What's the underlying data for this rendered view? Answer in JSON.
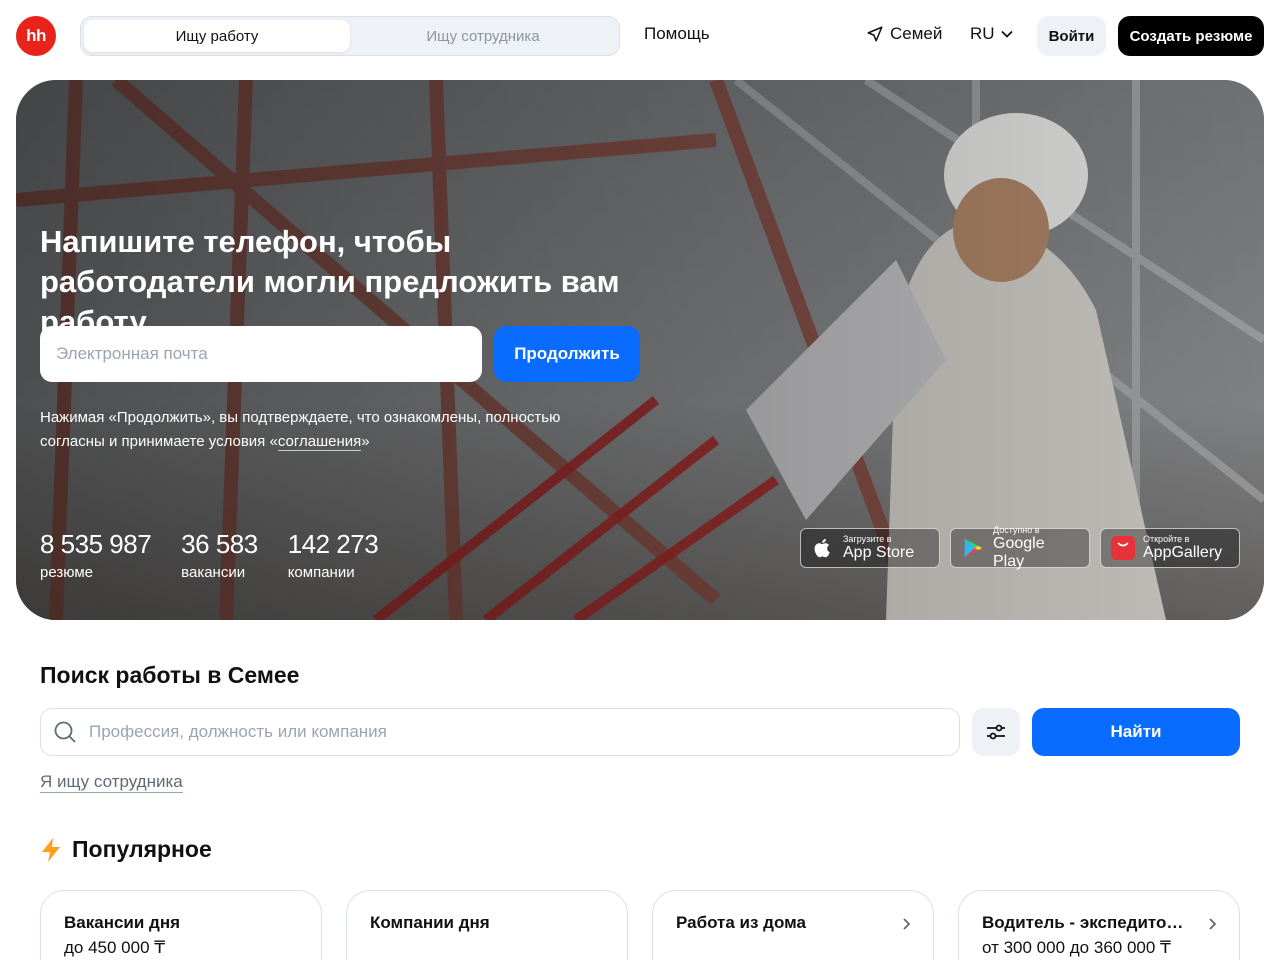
{
  "header": {
    "logo_text": "hh",
    "role_tabs": [
      "Ищу работу",
      "Ищу сотрудника"
    ],
    "help_label": "Помощь",
    "city": "Семей",
    "language": "RU",
    "login_label": "Войти",
    "create_resume_label": "Создать резюме"
  },
  "hero": {
    "title": "Напишите телефон, чтобы работодатели могли предложить вам работу",
    "email_placeholder": "Электронная почта",
    "continue_label": "Продолжить",
    "consent_text": "Нажимая «Продолжить», вы подтверждаете, что ознакомлены, полностью согласны и принимаете условия «",
    "consent_link": "соглашения",
    "consent_end": "»",
    "stats": [
      {
        "value": "8 535 987",
        "label": "резюме"
      },
      {
        "value": "36 583",
        "label": "вакансии"
      },
      {
        "value": "142 273",
        "label": "компании"
      }
    ],
    "stores": [
      {
        "small": "Загрузите в",
        "big": "App Store",
        "icon": "apple-icon"
      },
      {
        "small": "Доступно в",
        "big": "Google Play",
        "icon": "google-play-icon"
      },
      {
        "small": "Откройте в",
        "big": "AppGallery",
        "icon": "huawei-appgallery-icon"
      }
    ]
  },
  "search": {
    "title": "Поиск работы в Семее",
    "placeholder": "Профессия, должность или компания",
    "find_label": "Найти",
    "employer_link": "Я ищу сотрудника"
  },
  "popular": {
    "title": "Популярное",
    "cards": [
      {
        "title": "Вакансии дня",
        "subtitle": "до 450 000 ₸",
        "chevron": false
      },
      {
        "title": "Компании дня",
        "subtitle": "",
        "chevron": false
      },
      {
        "title": "Работа из дома",
        "subtitle": "",
        "chevron": true
      },
      {
        "title": "Водитель - экспедитор...",
        "subtitle": "от 300 000 до 360 000 ₸",
        "chevron": true
      }
    ]
  },
  "colors": {
    "brand_red": "#e8231c",
    "accent_blue": "#0a6cff",
    "black": "#000000",
    "lightning": "#ff9f1c"
  }
}
